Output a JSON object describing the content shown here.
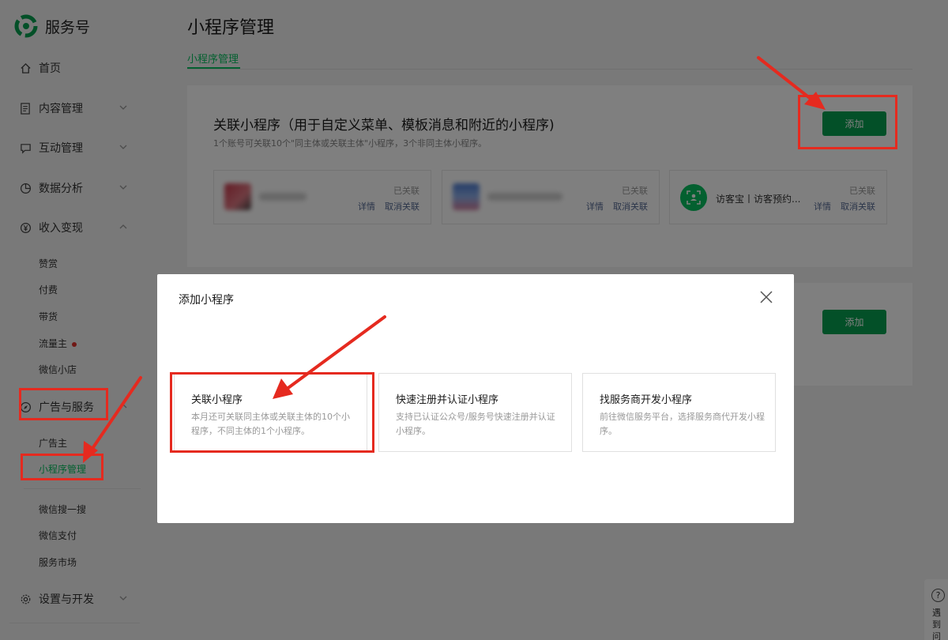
{
  "brand": {
    "name": "服务号"
  },
  "sidebar": {
    "items": [
      {
        "label": "首页",
        "icon": "home-icon"
      },
      {
        "label": "内容管理",
        "icon": "document-icon"
      },
      {
        "label": "互动管理",
        "icon": "chat-icon"
      },
      {
        "label": "数据分析",
        "icon": "pie-chart-icon"
      },
      {
        "label": "收入变现",
        "icon": "yen-circle-icon"
      },
      {
        "label": "广告与服务",
        "icon": "compass-icon"
      },
      {
        "label": "设置与开发",
        "icon": "gear-icon"
      }
    ],
    "income_sub": [
      "赞赏",
      "付费",
      "带货",
      "流量主",
      "微信小店"
    ],
    "ad_sub": [
      "广告主",
      "小程序管理",
      "微信搜一搜",
      "微信支付",
      "服务市场"
    ]
  },
  "main": {
    "title": "小程序管理",
    "tab": "小程序管理",
    "section1": {
      "title": "关联小程序（用于自定义菜单、模板消息和附近的小程序)",
      "desc": "1个账号可关联10个\"同主体或关联主体\"小程序，3个非同主体小程序。",
      "add_label": "添加",
      "minis": [
        {
          "name": "",
          "status": "已关联",
          "detail": "详情",
          "unlink": "取消关联"
        },
        {
          "name": "",
          "status": "已关联",
          "detail": "详情",
          "unlink": "取消关联"
        },
        {
          "name": "访客宝丨访客预约...",
          "status": "已关联",
          "detail": "详情",
          "unlink": "取消关联"
        }
      ]
    },
    "section2": {
      "add_label": "添加"
    }
  },
  "modal": {
    "title": "添加小程序",
    "options": [
      {
        "title": "关联小程序",
        "desc": "本月还可关联同主体或关联主体的10个小程序，不同主体的1个小程序。"
      },
      {
        "title": "快速注册并认证小程序",
        "desc": "支持已认证公众号/服务号快速注册并认证小程序。"
      },
      {
        "title": "找服务商开发小程序",
        "desc": "前往微信服务平台，选择服务商代开发小程序。"
      }
    ]
  },
  "help": {
    "q": "?",
    "text": "遇到问"
  },
  "colors": {
    "accent": "#07c160",
    "button": "#07a150",
    "annotation": "#e52a1f",
    "link": "#576b95"
  }
}
